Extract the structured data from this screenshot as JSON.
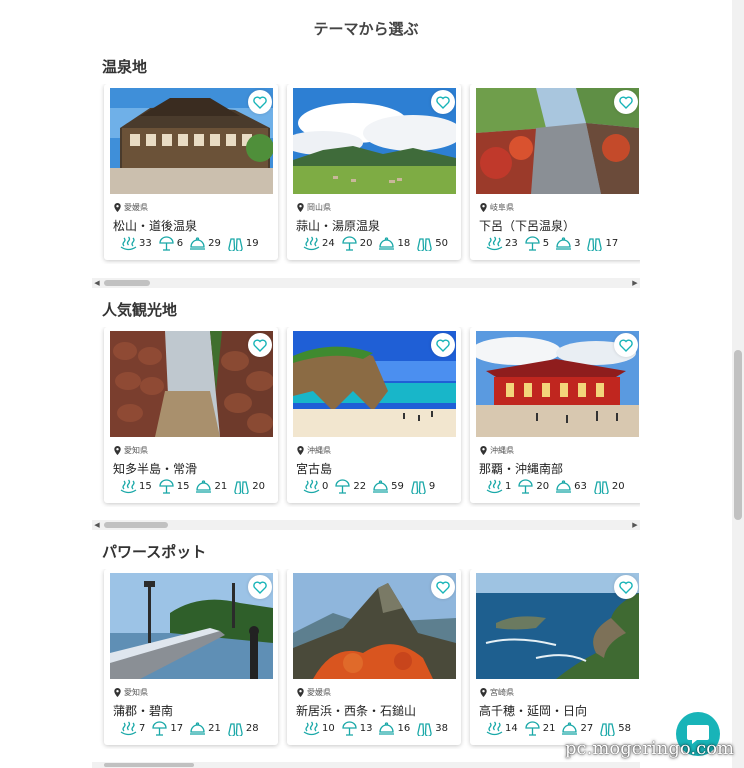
{
  "page": {
    "title": "テーマから選ぶ"
  },
  "colors": {
    "accent": "#18b4b8",
    "icon": "#1aa8a8"
  },
  "stat_icons": [
    "hot-spring-icon",
    "sun-umbrella-icon",
    "dome-icon",
    "binoculars-icon"
  ],
  "sections": [
    {
      "heading": "温泉地",
      "cards": [
        {
          "prefecture": "愛媛県",
          "place": "松山・道後温泉",
          "stats": [
            "33",
            "6",
            "29",
            "19"
          ],
          "photo": "dogo-onsen-building"
        },
        {
          "prefecture": "岡山県",
          "place": "蒜山・湯原温泉",
          "stats": [
            "24",
            "20",
            "18",
            "50"
          ],
          "photo": "hiruzen-plateau"
        },
        {
          "prefecture": "岐阜県",
          "place": "下呂（下呂温泉）",
          "stats": [
            "23",
            "5",
            "3",
            "17"
          ],
          "photo": "gero-river"
        }
      ]
    },
    {
      "heading": "人気観光地",
      "cards": [
        {
          "prefecture": "愛知県",
          "place": "知多半島・常滑",
          "stats": [
            "15",
            "15",
            "21",
            "20"
          ],
          "photo": "tokoname-pottery-lane"
        },
        {
          "prefecture": "沖縄県",
          "place": "宮古島",
          "stats": [
            "0",
            "22",
            "59",
            "9"
          ],
          "photo": "miyako-beach-arch"
        },
        {
          "prefecture": "沖縄県",
          "place": "那覇・沖縄南部",
          "stats": [
            "1",
            "20",
            "63",
            "20"
          ],
          "photo": "shuri-castle"
        }
      ]
    },
    {
      "heading": "パワースポット",
      "cards": [
        {
          "prefecture": "愛知県",
          "place": "蒲郡・碧南",
          "stats": [
            "7",
            "17",
            "21",
            "28"
          ],
          "photo": "takeshima-bridge"
        },
        {
          "prefecture": "愛媛県",
          "place": "新居浜・西条・石鎚山",
          "stats": [
            "10",
            "13",
            "16",
            "38"
          ],
          "photo": "ishizuchi-mountain"
        },
        {
          "prefecture": "宮崎県",
          "place": "高千穂・延岡・日向",
          "stats": [
            "14",
            "21",
            "27",
            "58"
          ],
          "photo": "coastal-cliffs"
        }
      ]
    }
  ],
  "watermark": "pc.mogeringo.com"
}
